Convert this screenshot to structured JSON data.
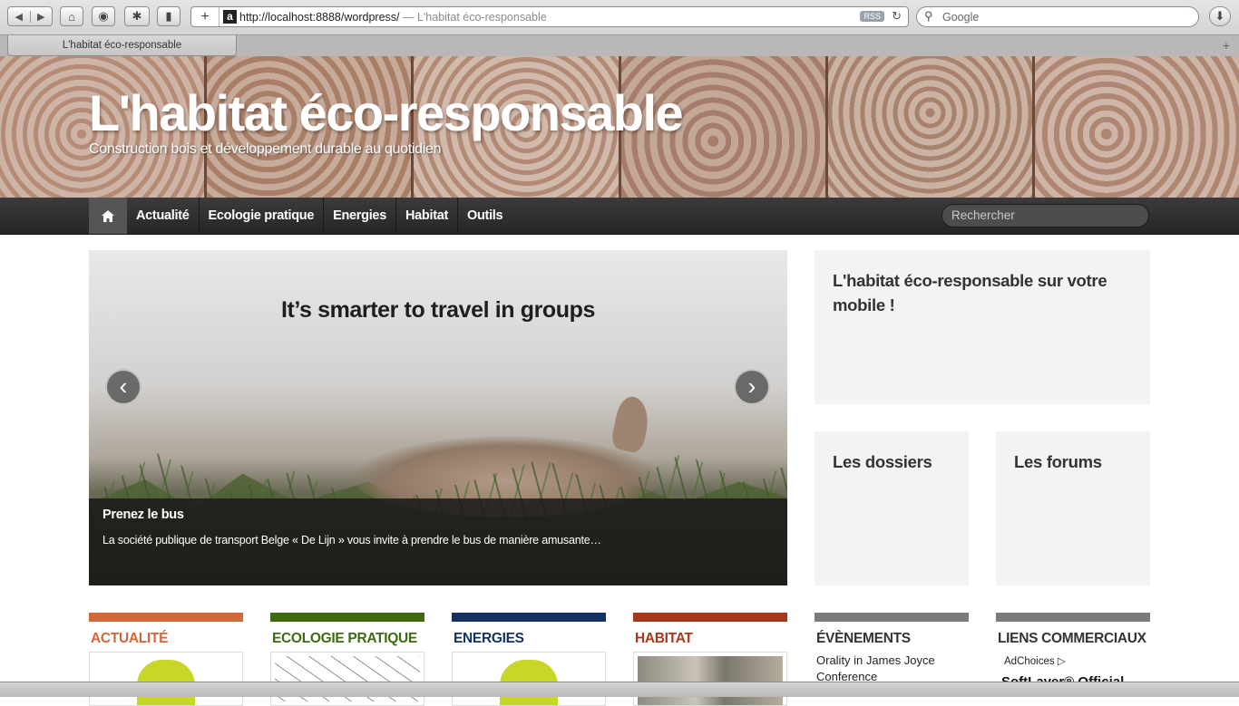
{
  "browser": {
    "url": "http://localhost:8888/wordpress/",
    "page_title_suffix": "— L'habitat éco-responsable",
    "rss_label": "RSS",
    "search_placeholder": "Google",
    "tab_title": "L'habitat éco-responsable",
    "favicon_letter": "a"
  },
  "site": {
    "title": "L'habitat éco-responsable",
    "description": "Construction bois et développement durable au quotidien"
  },
  "nav": {
    "items": [
      "Actualité",
      "Ecologie pratique",
      "Energies",
      "Habitat",
      "Outils"
    ],
    "search_placeholder": "Rechercher"
  },
  "slider": {
    "image_headline": "It’s smarter to travel in groups",
    "prev_label": "‹",
    "next_label": "›",
    "caption_title": "Prenez le bus",
    "caption_text": "La société publique de transport Belge « De Lijn » vous invite à prendre le bus de manière amusante…"
  },
  "widgets": {
    "mobile_title": "L'habitat éco-responsable sur votre mobile !",
    "dossiers_title": "Les dossiers",
    "forums_title": "Les forums"
  },
  "categories": [
    {
      "label": "ACTUALITÉ",
      "color": "#d2673a"
    },
    {
      "label": "ECOLOGIE PRATIQUE",
      "color": "#3f6a10"
    },
    {
      "label": "ENERGIES",
      "color": "#13325f"
    },
    {
      "label": "HABITAT",
      "color": "#a8381b"
    },
    {
      "label": "ÉVÈNEMENTS",
      "color": "#7b7b7b"
    },
    {
      "label": "LIENS COMMERCIAUX",
      "color": "#7b7b7b"
    }
  ],
  "events": {
    "first_item": "Orality in James Joyce Conference"
  },
  "ads": {
    "adchoices": "AdChoices",
    "first_ad": "SoftLayer® Official"
  }
}
